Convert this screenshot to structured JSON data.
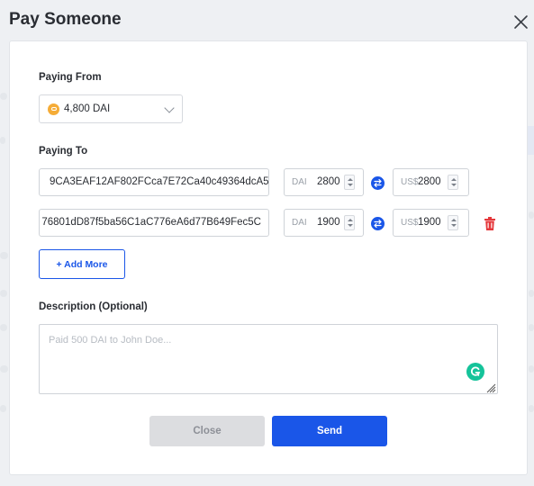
{
  "modal": {
    "title": "Pay Someone"
  },
  "paying_from": {
    "label": "Paying From",
    "wallet_value": "4,800 DAI"
  },
  "paying_to": {
    "label": "Paying To",
    "recipients": [
      {
        "address": "9CA3EAF12AF802FCca7E72Ca40c49364dcA5",
        "token_unit": "DAI",
        "token_amount": "2800",
        "fiat_unit": "US$",
        "fiat_amount": "2800"
      },
      {
        "address": "76801dD87f5ba56C1aC776eA6d77B649Fec5C",
        "token_unit": "DAI",
        "token_amount": "1900",
        "fiat_unit": "US$",
        "fiat_amount": "1900"
      }
    ],
    "add_more_label": "+ Add More"
  },
  "description": {
    "label": "Description (Optional)",
    "placeholder": "Paid 500 DAI to John Doe..."
  },
  "actions": {
    "close_label": "Close",
    "send_label": "Send"
  },
  "colors": {
    "accent": "#1a56e8",
    "danger": "#e5383b",
    "dai": "#f5ac37",
    "grammarly": "#15c39a"
  }
}
